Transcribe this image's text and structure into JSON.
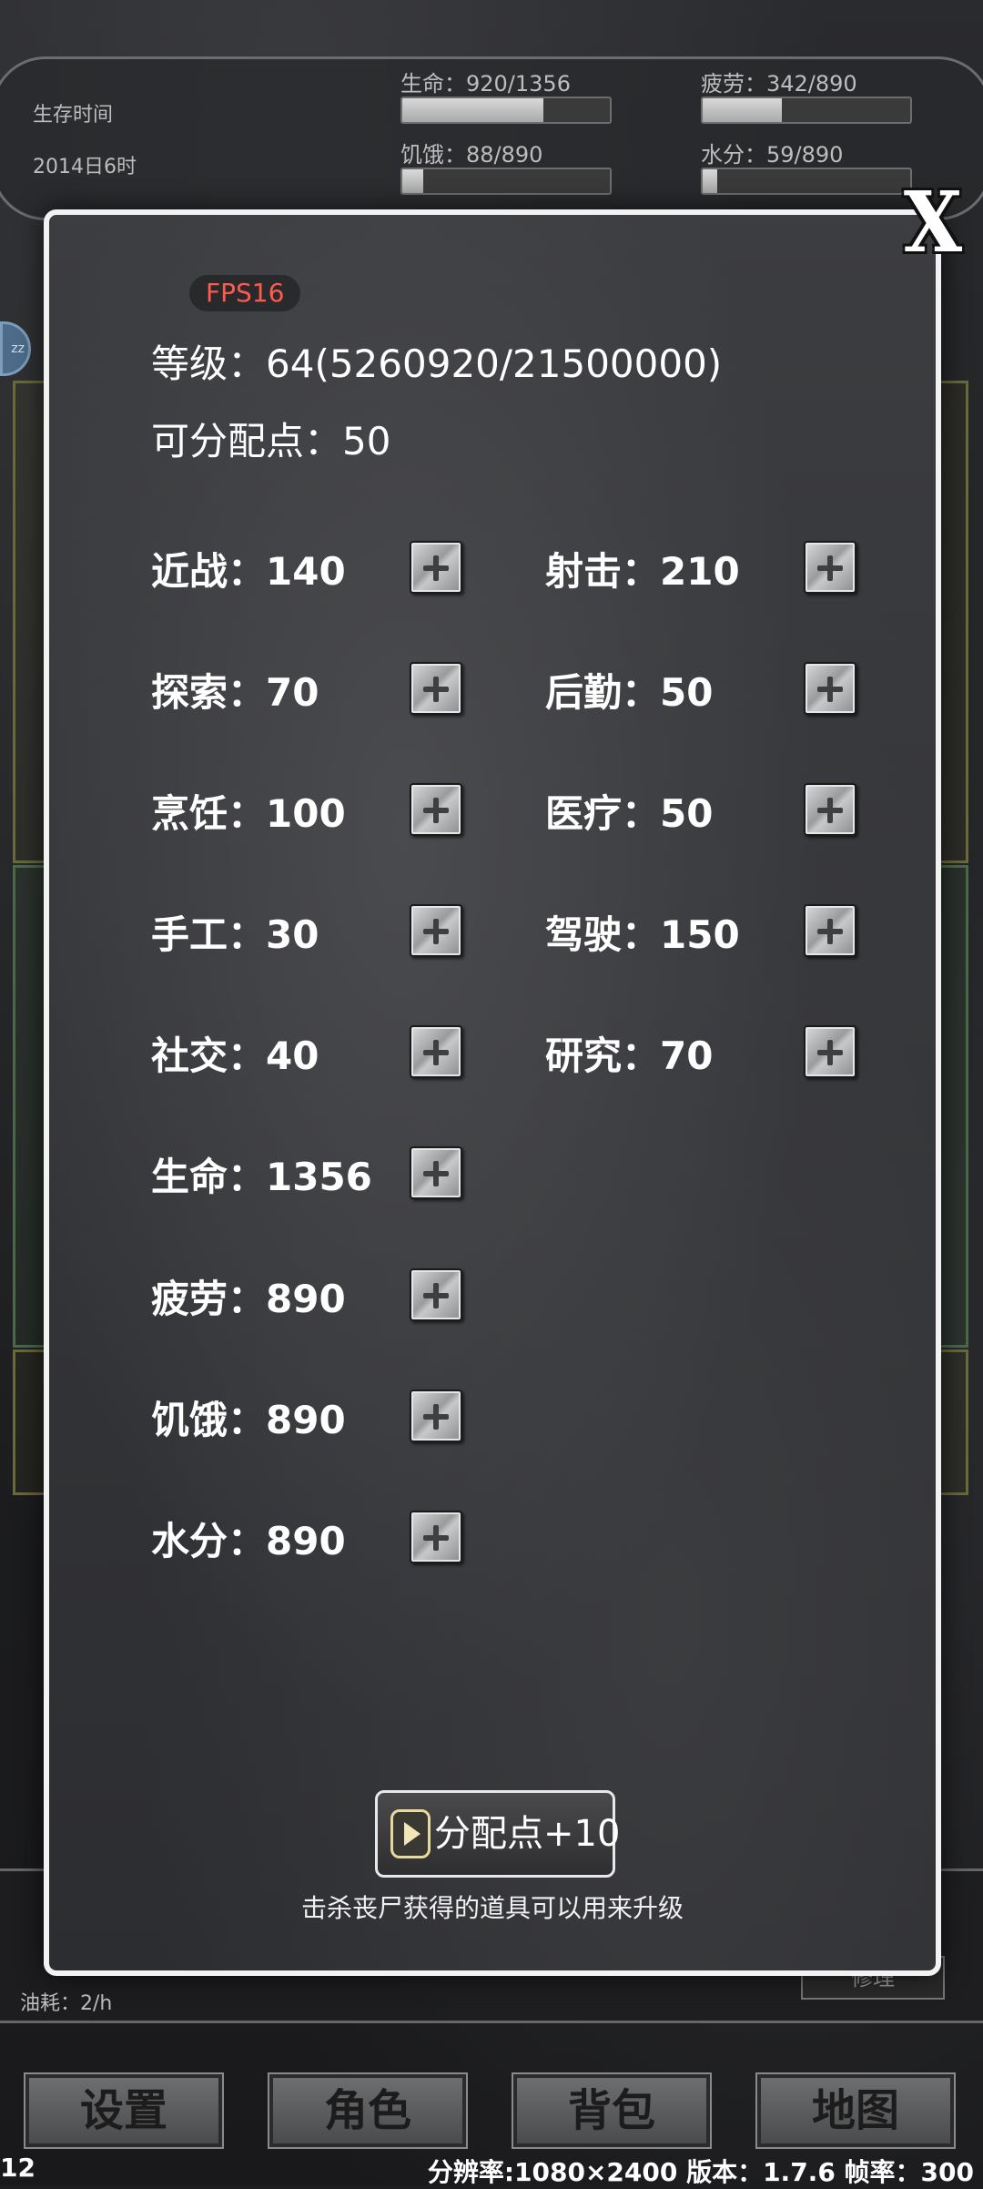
{
  "header": {
    "survive_label": "生存时间",
    "survive_date": "2014日6时",
    "stats": [
      {
        "label": "生命：920/1356",
        "fill": 0.68
      },
      {
        "label": "疲劳：342/890",
        "fill": 0.38
      },
      {
        "label": "饥饿：88/890",
        "fill": 0.1
      },
      {
        "label": "水分：59/890",
        "fill": 0.07
      }
    ]
  },
  "dialog": {
    "fps": "FPS16",
    "level": "等级：64(5260920/21500000)",
    "points": "可分配点：50",
    "attributes_left": [
      "近战：140",
      "探索：70",
      "烹饪：100",
      "手工：30",
      "社交：40",
      "生命：1356",
      "疲劳：890",
      "饥饿：890",
      "水分：890"
    ],
    "attributes_right": [
      "射击：210",
      "后勤：50",
      "医疗：50",
      "驾驶：150",
      "研究：70"
    ],
    "alloc_button": "分配点+10",
    "hint": "击杀丧尸获得的道具可以用来升级",
    "close_glyph": "X"
  },
  "background": {
    "fuel": "油耗：2/h",
    "repair": "修理"
  },
  "nav": [
    "设置",
    "角色",
    "背包",
    "地图"
  ],
  "footer": {
    "left": "12",
    "right": "分辨率:1080×2400  版本：1.7.6  帧率：300"
  }
}
